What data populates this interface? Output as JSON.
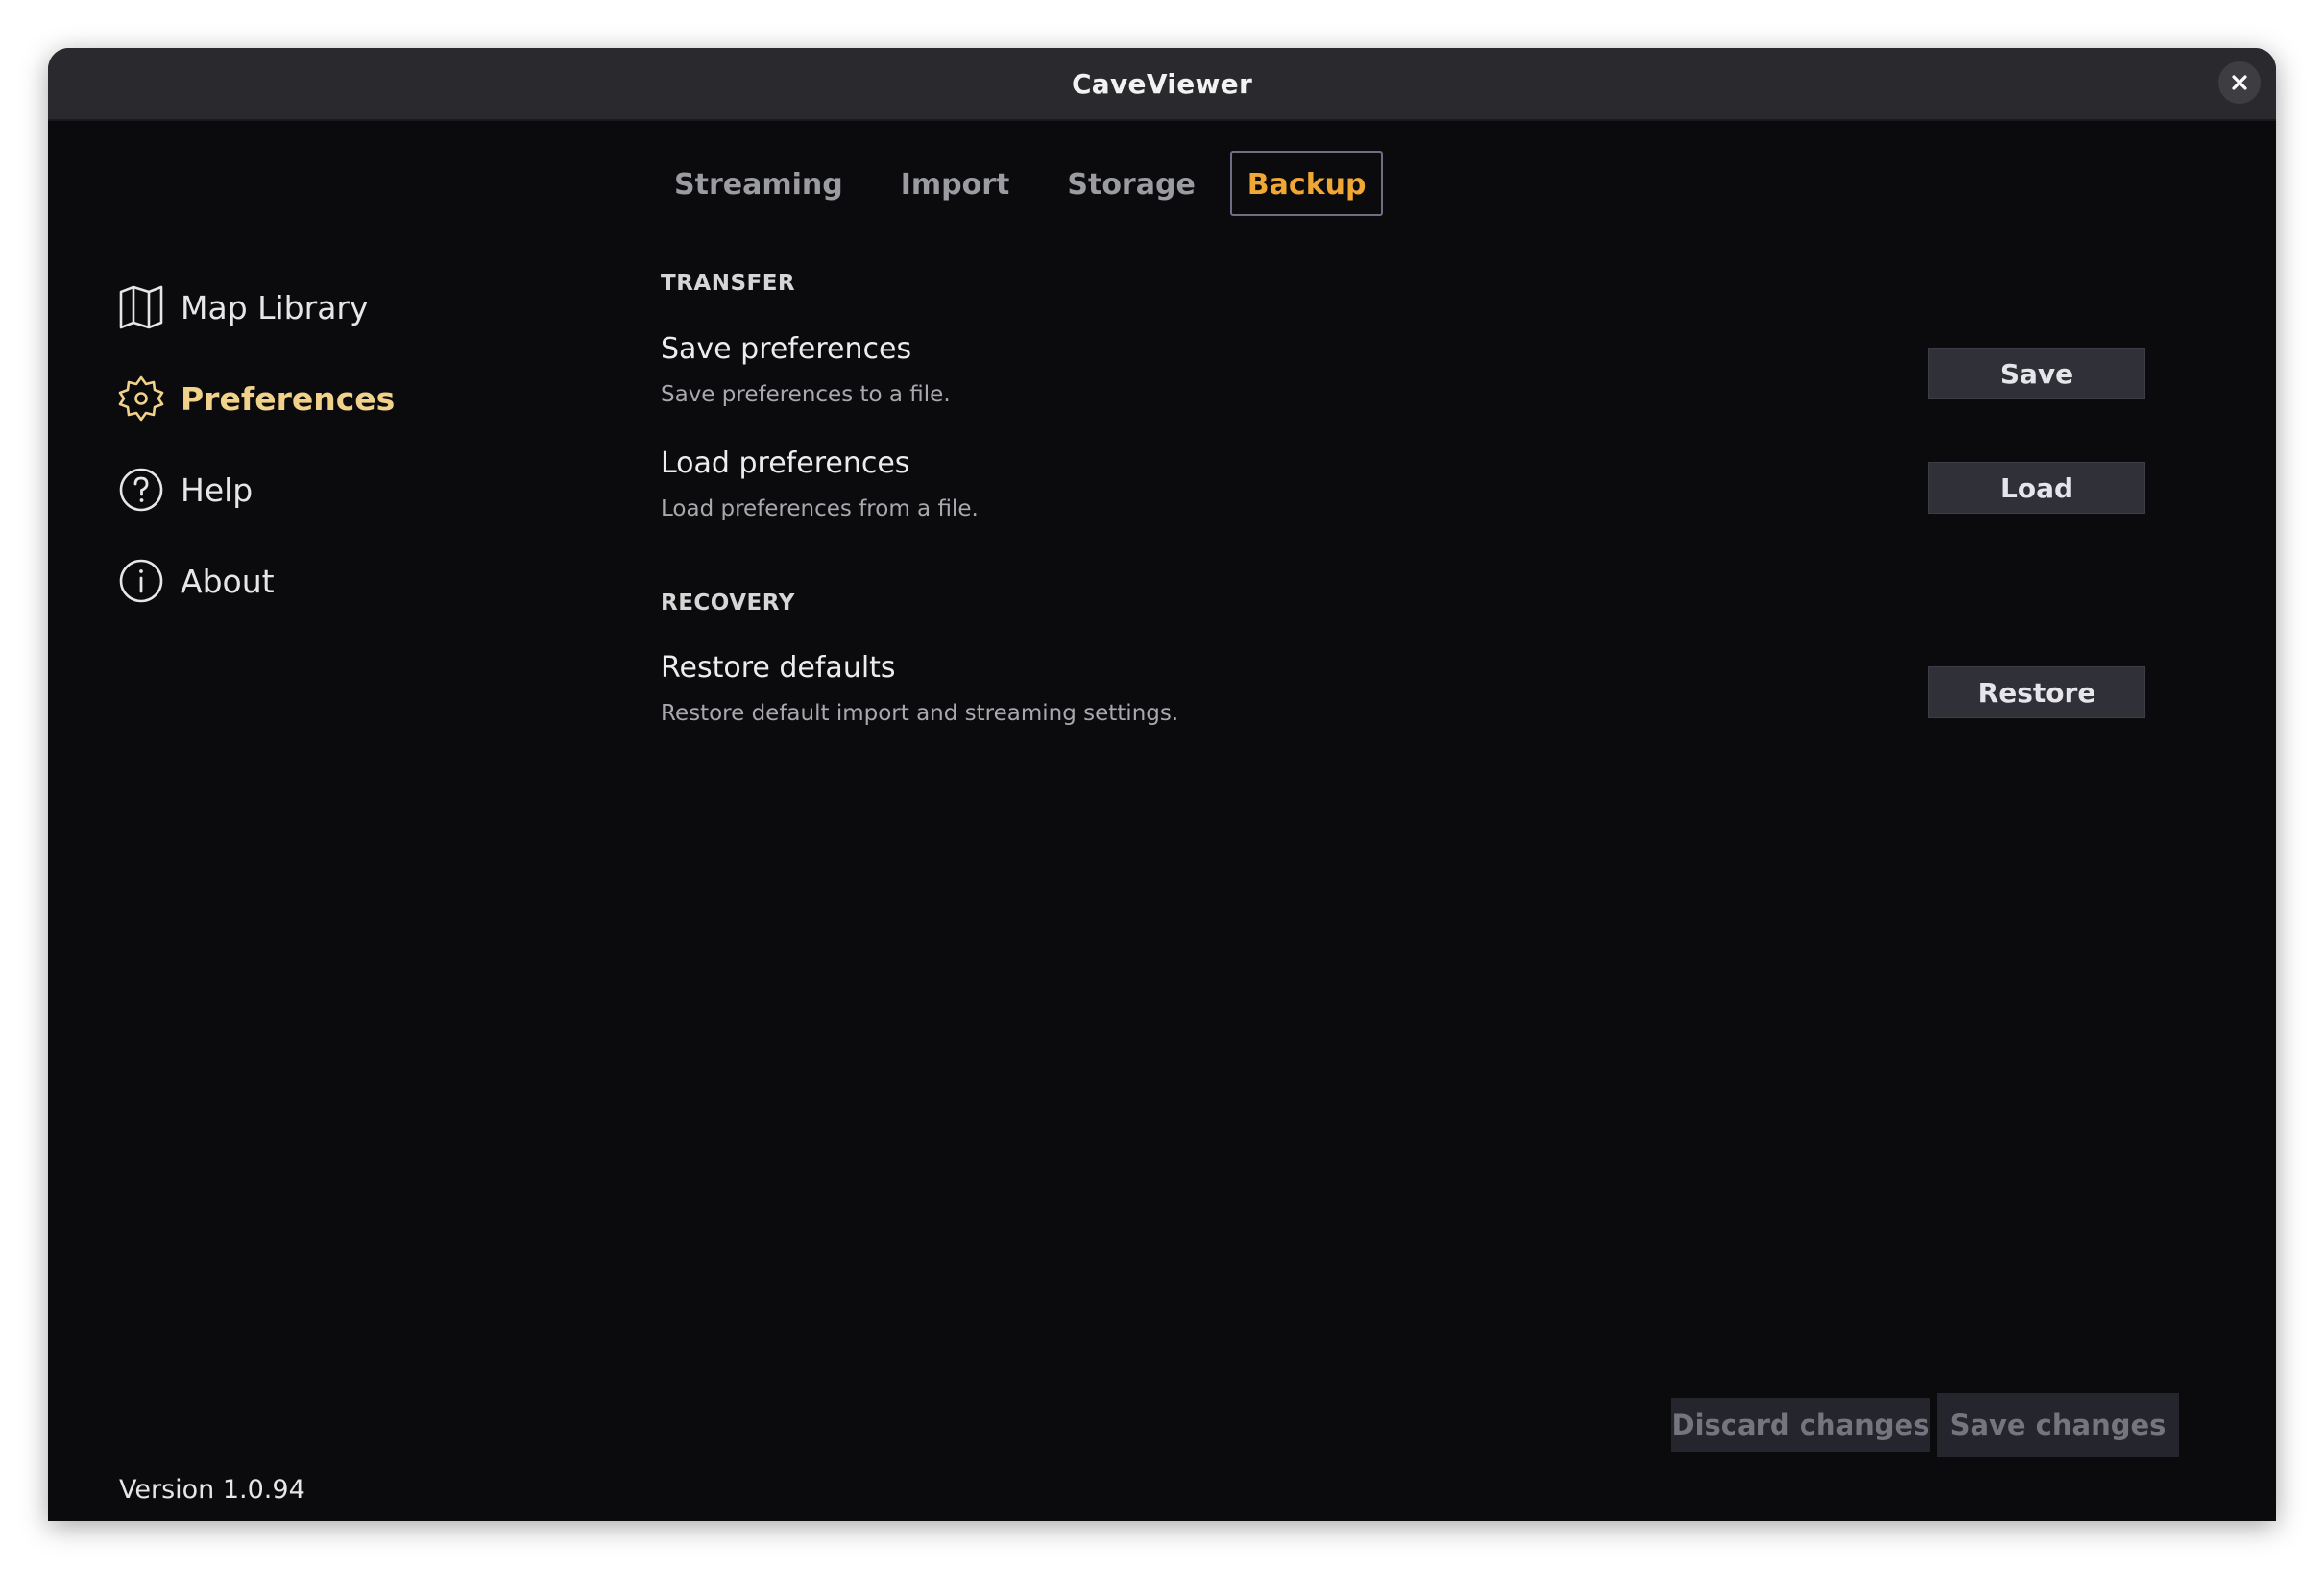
{
  "window": {
    "title": "CaveViewer"
  },
  "sidebar": {
    "items": [
      {
        "label": "Map Library",
        "icon": "map-icon"
      },
      {
        "label": "Preferences",
        "icon": "gear-icon",
        "active": true
      },
      {
        "label": "Help",
        "icon": "help-icon"
      },
      {
        "label": "About",
        "icon": "info-icon"
      }
    ],
    "version": "Version 1.0.94"
  },
  "tabs": [
    {
      "label": "Streaming"
    },
    {
      "label": "Import"
    },
    {
      "label": "Storage"
    },
    {
      "label": "Backup",
      "active": true
    }
  ],
  "sections": {
    "transfer": {
      "heading": "TRANSFER",
      "save": {
        "title": "Save preferences",
        "description": "Save preferences to a file.",
        "button": "Save"
      },
      "load": {
        "title": "Load preferences",
        "description": "Load preferences from a file.",
        "button": "Load"
      }
    },
    "recovery": {
      "heading": "RECOVERY",
      "restore": {
        "title": "Restore defaults",
        "description": "Restore default import and streaming settings.",
        "button": "Restore"
      }
    }
  },
  "footer": {
    "discard_label": "Discard changes",
    "save_label": "Save changes"
  },
  "colors": {
    "accent_active_nav": "#f1d28a",
    "accent_active_tab": "#f0a733",
    "window_bg": "#0b0b0d",
    "titlebar_bg": "#2a2a2e"
  }
}
